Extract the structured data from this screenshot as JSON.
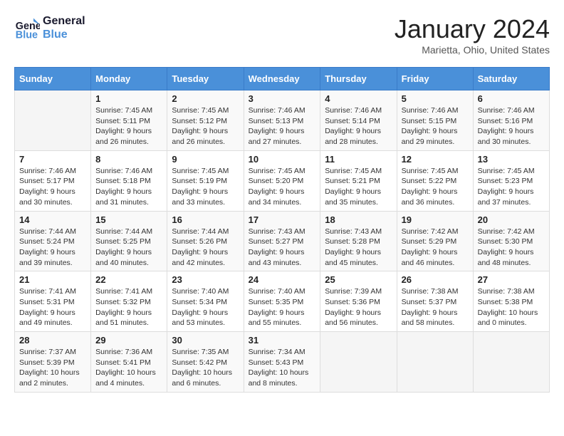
{
  "logo": {
    "line1": "General",
    "line2": "Blue"
  },
  "title": "January 2024",
  "location": "Marietta, Ohio, United States",
  "header_days": [
    "Sunday",
    "Monday",
    "Tuesday",
    "Wednesday",
    "Thursday",
    "Friday",
    "Saturday"
  ],
  "weeks": [
    [
      {
        "num": "",
        "sunrise": "",
        "sunset": "",
        "daylight": ""
      },
      {
        "num": "1",
        "sunrise": "Sunrise: 7:45 AM",
        "sunset": "Sunset: 5:11 PM",
        "daylight": "Daylight: 9 hours and 26 minutes."
      },
      {
        "num": "2",
        "sunrise": "Sunrise: 7:45 AM",
        "sunset": "Sunset: 5:12 PM",
        "daylight": "Daylight: 9 hours and 26 minutes."
      },
      {
        "num": "3",
        "sunrise": "Sunrise: 7:46 AM",
        "sunset": "Sunset: 5:13 PM",
        "daylight": "Daylight: 9 hours and 27 minutes."
      },
      {
        "num": "4",
        "sunrise": "Sunrise: 7:46 AM",
        "sunset": "Sunset: 5:14 PM",
        "daylight": "Daylight: 9 hours and 28 minutes."
      },
      {
        "num": "5",
        "sunrise": "Sunrise: 7:46 AM",
        "sunset": "Sunset: 5:15 PM",
        "daylight": "Daylight: 9 hours and 29 minutes."
      },
      {
        "num": "6",
        "sunrise": "Sunrise: 7:46 AM",
        "sunset": "Sunset: 5:16 PM",
        "daylight": "Daylight: 9 hours and 30 minutes."
      }
    ],
    [
      {
        "num": "7",
        "sunrise": "Sunrise: 7:46 AM",
        "sunset": "Sunset: 5:17 PM",
        "daylight": "Daylight: 9 hours and 30 minutes."
      },
      {
        "num": "8",
        "sunrise": "Sunrise: 7:46 AM",
        "sunset": "Sunset: 5:18 PM",
        "daylight": "Daylight: 9 hours and 31 minutes."
      },
      {
        "num": "9",
        "sunrise": "Sunrise: 7:45 AM",
        "sunset": "Sunset: 5:19 PM",
        "daylight": "Daylight: 9 hours and 33 minutes."
      },
      {
        "num": "10",
        "sunrise": "Sunrise: 7:45 AM",
        "sunset": "Sunset: 5:20 PM",
        "daylight": "Daylight: 9 hours and 34 minutes."
      },
      {
        "num": "11",
        "sunrise": "Sunrise: 7:45 AM",
        "sunset": "Sunset: 5:21 PM",
        "daylight": "Daylight: 9 hours and 35 minutes."
      },
      {
        "num": "12",
        "sunrise": "Sunrise: 7:45 AM",
        "sunset": "Sunset: 5:22 PM",
        "daylight": "Daylight: 9 hours and 36 minutes."
      },
      {
        "num": "13",
        "sunrise": "Sunrise: 7:45 AM",
        "sunset": "Sunset: 5:23 PM",
        "daylight": "Daylight: 9 hours and 37 minutes."
      }
    ],
    [
      {
        "num": "14",
        "sunrise": "Sunrise: 7:44 AM",
        "sunset": "Sunset: 5:24 PM",
        "daylight": "Daylight: 9 hours and 39 minutes."
      },
      {
        "num": "15",
        "sunrise": "Sunrise: 7:44 AM",
        "sunset": "Sunset: 5:25 PM",
        "daylight": "Daylight: 9 hours and 40 minutes."
      },
      {
        "num": "16",
        "sunrise": "Sunrise: 7:44 AM",
        "sunset": "Sunset: 5:26 PM",
        "daylight": "Daylight: 9 hours and 42 minutes."
      },
      {
        "num": "17",
        "sunrise": "Sunrise: 7:43 AM",
        "sunset": "Sunset: 5:27 PM",
        "daylight": "Daylight: 9 hours and 43 minutes."
      },
      {
        "num": "18",
        "sunrise": "Sunrise: 7:43 AM",
        "sunset": "Sunset: 5:28 PM",
        "daylight": "Daylight: 9 hours and 45 minutes."
      },
      {
        "num": "19",
        "sunrise": "Sunrise: 7:42 AM",
        "sunset": "Sunset: 5:29 PM",
        "daylight": "Daylight: 9 hours and 46 minutes."
      },
      {
        "num": "20",
        "sunrise": "Sunrise: 7:42 AM",
        "sunset": "Sunset: 5:30 PM",
        "daylight": "Daylight: 9 hours and 48 minutes."
      }
    ],
    [
      {
        "num": "21",
        "sunrise": "Sunrise: 7:41 AM",
        "sunset": "Sunset: 5:31 PM",
        "daylight": "Daylight: 9 hours and 49 minutes."
      },
      {
        "num": "22",
        "sunrise": "Sunrise: 7:41 AM",
        "sunset": "Sunset: 5:32 PM",
        "daylight": "Daylight: 9 hours and 51 minutes."
      },
      {
        "num": "23",
        "sunrise": "Sunrise: 7:40 AM",
        "sunset": "Sunset: 5:34 PM",
        "daylight": "Daylight: 9 hours and 53 minutes."
      },
      {
        "num": "24",
        "sunrise": "Sunrise: 7:40 AM",
        "sunset": "Sunset: 5:35 PM",
        "daylight": "Daylight: 9 hours and 55 minutes."
      },
      {
        "num": "25",
        "sunrise": "Sunrise: 7:39 AM",
        "sunset": "Sunset: 5:36 PM",
        "daylight": "Daylight: 9 hours and 56 minutes."
      },
      {
        "num": "26",
        "sunrise": "Sunrise: 7:38 AM",
        "sunset": "Sunset: 5:37 PM",
        "daylight": "Daylight: 9 hours and 58 minutes."
      },
      {
        "num": "27",
        "sunrise": "Sunrise: 7:38 AM",
        "sunset": "Sunset: 5:38 PM",
        "daylight": "Daylight: 10 hours and 0 minutes."
      }
    ],
    [
      {
        "num": "28",
        "sunrise": "Sunrise: 7:37 AM",
        "sunset": "Sunset: 5:39 PM",
        "daylight": "Daylight: 10 hours and 2 minutes."
      },
      {
        "num": "29",
        "sunrise": "Sunrise: 7:36 AM",
        "sunset": "Sunset: 5:41 PM",
        "daylight": "Daylight: 10 hours and 4 minutes."
      },
      {
        "num": "30",
        "sunrise": "Sunrise: 7:35 AM",
        "sunset": "Sunset: 5:42 PM",
        "daylight": "Daylight: 10 hours and 6 minutes."
      },
      {
        "num": "31",
        "sunrise": "Sunrise: 7:34 AM",
        "sunset": "Sunset: 5:43 PM",
        "daylight": "Daylight: 10 hours and 8 minutes."
      },
      {
        "num": "",
        "sunrise": "",
        "sunset": "",
        "daylight": ""
      },
      {
        "num": "",
        "sunrise": "",
        "sunset": "",
        "daylight": ""
      },
      {
        "num": "",
        "sunrise": "",
        "sunset": "",
        "daylight": ""
      }
    ]
  ]
}
